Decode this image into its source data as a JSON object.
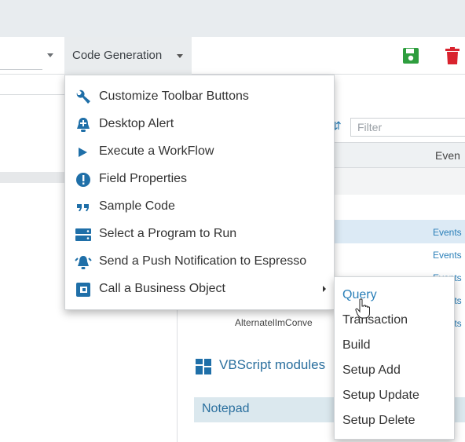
{
  "toolbar": {
    "code_generation_label": "Code Generation",
    "filter_placeholder": "Filter",
    "events_column_header": "Even"
  },
  "grid": {
    "event_links": [
      "Events",
      "Events",
      "Events",
      "Events",
      "Events"
    ],
    "alternate_row_text": "AlternatelImConve"
  },
  "sections": {
    "vbscript_label": "VBScript modules",
    "notepad_label": "Notepad"
  },
  "menu": {
    "items": [
      {
        "label": "Customize Toolbar Buttons",
        "icon": "wrench-icon"
      },
      {
        "label": "Desktop Alert",
        "icon": "bell-plus-icon"
      },
      {
        "label": "Execute a WorkFlow",
        "icon": "play-icon"
      },
      {
        "label": "Field Properties",
        "icon": "exclamation-circle-icon"
      },
      {
        "label": "Sample Code",
        "icon": "quote-icon"
      },
      {
        "label": "Select a Program to Run",
        "icon": "server-icon"
      },
      {
        "label": "Send a Push Notification to Espresso",
        "icon": "bell-ring-icon"
      },
      {
        "label": "Call a Business Object",
        "icon": "business-object-icon"
      }
    ]
  },
  "submenu": {
    "items": [
      "Query",
      "Transaction",
      "Build",
      "Setup Add",
      "Setup Update",
      "Setup Delete"
    ]
  },
  "colors": {
    "accent": "#2a7fb8",
    "save": "#2e9e3e",
    "delete": "#d9232e"
  }
}
